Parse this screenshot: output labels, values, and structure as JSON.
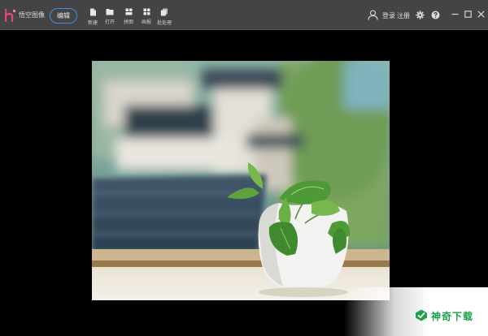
{
  "app": {
    "name": "悟空图像",
    "edit_label": "编辑"
  },
  "toolbar": [
    {
      "label": "新建",
      "icon": "new-file-icon"
    },
    {
      "label": "打开",
      "icon": "open-folder-icon"
    },
    {
      "label": "拼图",
      "icon": "collage-icon"
    },
    {
      "label": "画报",
      "icon": "poster-icon"
    },
    {
      "label": "批处理",
      "icon": "batch-icon"
    }
  ],
  "account": {
    "login": "登录",
    "register": "注册"
  },
  "watermark": {
    "text": "神奇下载"
  },
  "colors": {
    "titlebar": "#444444",
    "accent": "#3d8fe8",
    "logo": "#e0467e",
    "watermark_green": "#1aa24a"
  }
}
